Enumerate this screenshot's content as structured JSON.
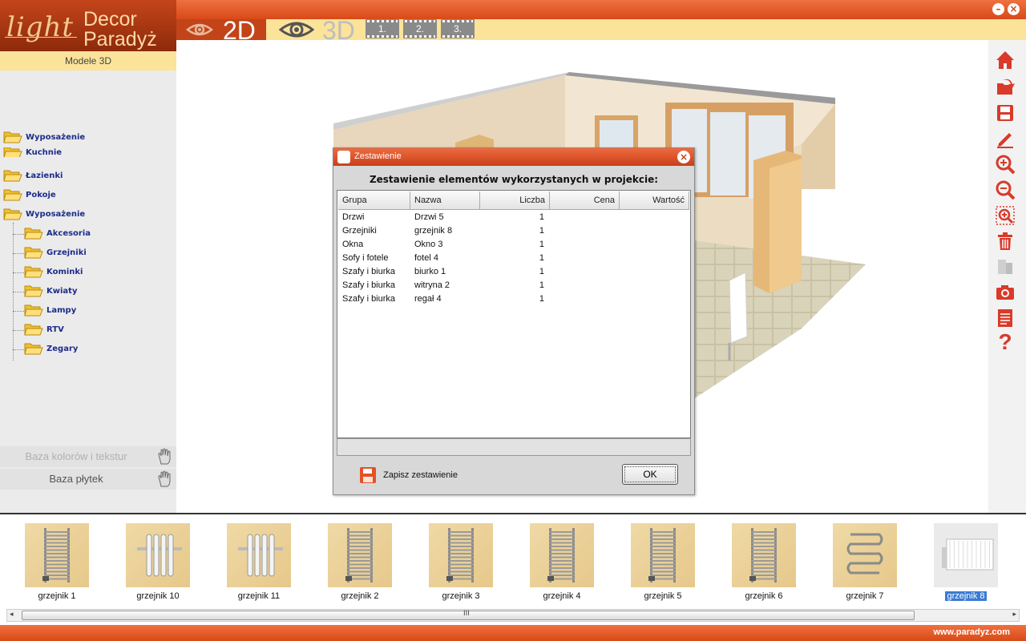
{
  "window": {
    "minimize_label": "–",
    "close_label": "×"
  },
  "logo": {
    "light": "light",
    "line1": "Decor",
    "line2": "Paradyż"
  },
  "views": {
    "view_2d": "2D",
    "view_3d": "3D",
    "cameras": [
      "1.",
      "2.",
      "3."
    ]
  },
  "sidebar": {
    "header": "Modele 3D",
    "tree": [
      {
        "label": "Wyposażenie",
        "level": 0
      },
      {
        "label": "Kuchnie",
        "level": 0
      },
      {
        "label": "Łazienki",
        "level": 0
      },
      {
        "label": "Pokoje",
        "level": 0
      },
      {
        "label": "Wyposażenie",
        "level": 0
      },
      {
        "label": "Akcesoria",
        "level": 1
      },
      {
        "label": "Grzejniki",
        "level": 1
      },
      {
        "label": "Kominki",
        "level": 1
      },
      {
        "label": "Kwiaty",
        "level": 1
      },
      {
        "label": "Lampy",
        "level": 1
      },
      {
        "label": "RTV",
        "level": 1
      },
      {
        "label": "Zegary",
        "level": 1
      }
    ],
    "color_base_button": "Baza kolorów i tekstur",
    "tile_base_button": "Baza płytek"
  },
  "toolbar": {
    "tools": [
      "home-icon",
      "open-folder-icon",
      "save-icon",
      "pencil-icon",
      "zoom-in-icon",
      "zoom-out-icon",
      "zoom-region-icon",
      "trash-icon",
      "panel-icon",
      "camera-icon",
      "report-icon",
      "help-icon"
    ],
    "help_glyph": "?"
  },
  "dialog": {
    "title": "Zestawienie",
    "heading": "Zestawienie elementów wykorzystanych w projekcie:",
    "columns": [
      "Grupa",
      "Nazwa",
      "Liczba",
      "Cena",
      "Wartość"
    ],
    "rows": [
      {
        "grupa": "Drzwi",
        "nazwa": "Drzwi 5",
        "liczba": "1",
        "cena": "",
        "wartosc": ""
      },
      {
        "grupa": "Grzejniki",
        "nazwa": "grzejnik 8",
        "liczba": "1",
        "cena": "",
        "wartosc": ""
      },
      {
        "grupa": "Okna",
        "nazwa": "Okno 3",
        "liczba": "1",
        "cena": "",
        "wartosc": ""
      },
      {
        "grupa": "Sofy i fotele",
        "nazwa": "fotel 4",
        "liczba": "1",
        "cena": "",
        "wartosc": ""
      },
      {
        "grupa": "Szafy i biurka",
        "nazwa": "biurko 1",
        "liczba": "1",
        "cena": "",
        "wartosc": ""
      },
      {
        "grupa": "Szafy i biurka",
        "nazwa": "witryna 2",
        "liczba": "1",
        "cena": "",
        "wartosc": ""
      },
      {
        "grupa": "Szafy i biurka",
        "nazwa": "regał 4",
        "liczba": "1",
        "cena": "",
        "wartosc": ""
      }
    ],
    "status_text": "",
    "save_label": "Zapisz zestawienie",
    "ok_label": "OK",
    "close_label": "×"
  },
  "catalog": {
    "items": [
      {
        "name": "grzejnik 1",
        "selected": false
      },
      {
        "name": "grzejnik 10",
        "selected": false
      },
      {
        "name": "grzejnik 11",
        "selected": false
      },
      {
        "name": "grzejnik 2",
        "selected": false
      },
      {
        "name": "grzejnik 3",
        "selected": false
      },
      {
        "name": "grzejnik 4",
        "selected": false
      },
      {
        "name": "grzejnik 5",
        "selected": false
      },
      {
        "name": "grzejnik 6",
        "selected": false
      },
      {
        "name": "grzejnik 7",
        "selected": false
      },
      {
        "name": "grzejnik 8",
        "selected": true
      }
    ],
    "scroll_grip": "III",
    "scroll_left": "◂",
    "scroll_right": "▸"
  },
  "footer": {
    "url": "www.paradyz.com"
  },
  "colors": {
    "brand_orange": "#d84a18",
    "accent_yellow": "#fbe39a",
    "tree_text": "#1d2c8a",
    "selection": "#3a7bd5"
  }
}
